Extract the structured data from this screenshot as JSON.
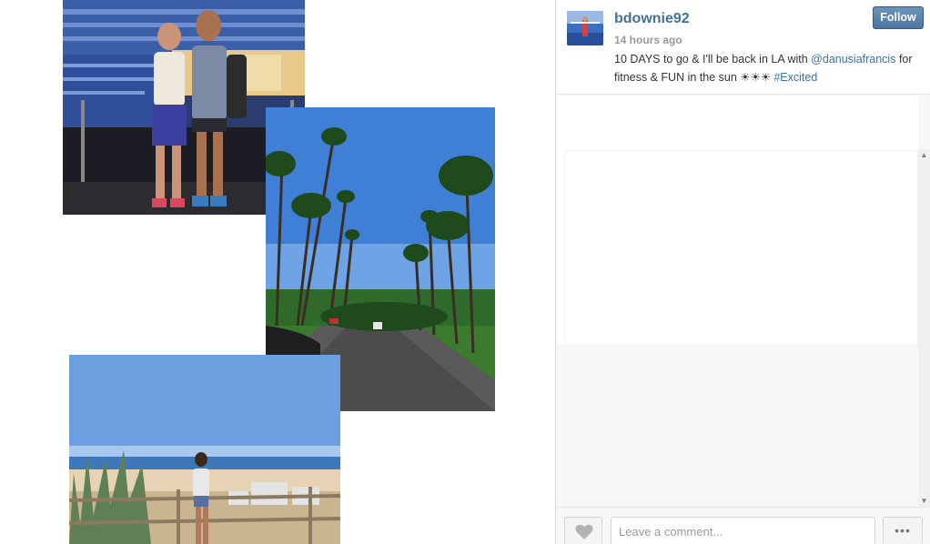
{
  "post": {
    "username": "bdownie92",
    "timestamp": "14 hours ago",
    "caption_parts": {
      "before": "10 DAYS to go & I'll be back in LA with ",
      "mention": "@danusiafrancis",
      "middle": " for fitness & FUN in the sun ☀☀☀ ",
      "hashtag": "#Excited"
    },
    "follow_label": "Follow"
  },
  "footer": {
    "comment_placeholder": "Leave a comment...",
    "more_label": "•••"
  },
  "icons": {
    "like": "heart-icon",
    "more": "ellipsis-icon",
    "scroll_up": "triangle-up-icon",
    "scroll_down": "triangle-down-icon"
  },
  "colors": {
    "link": "#3f729b",
    "follow_button": "#517fa4",
    "timestamp": "#999999"
  }
}
